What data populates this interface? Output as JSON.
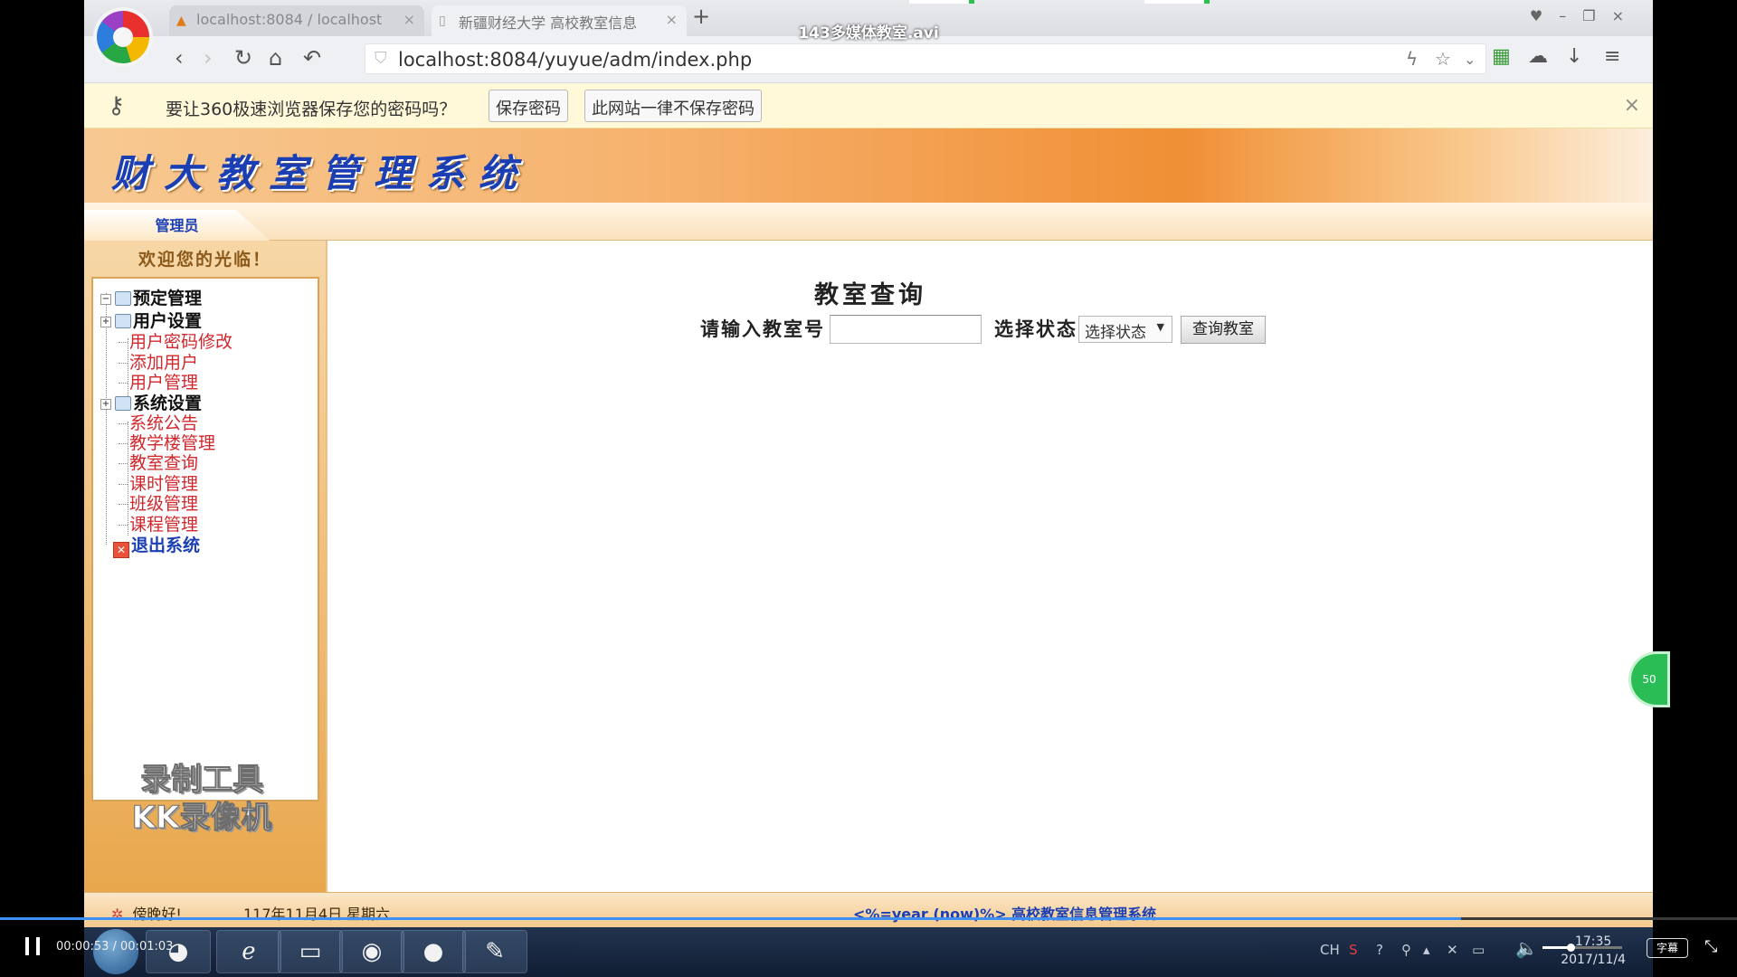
{
  "video": {
    "title": "143多媒体教室.avi",
    "time": "00:00:53 / 00:01:03",
    "progress": 0.841,
    "volume": 0.35,
    "subtitle_label": "字幕"
  },
  "browser": {
    "tabs": [
      {
        "label": "localhost:8084 / localhost",
        "icon": "phpmyadmin-icon"
      },
      {
        "label": "新疆财经大学 高校教室信息",
        "icon": "page-icon"
      }
    ],
    "new_tab": "+",
    "url": "localhost:8084/yuyue/adm/index.php",
    "password_bar": {
      "message": "要让360极速浏览器保存您的密码吗？",
      "save_label": "保存密码",
      "never_label": "此网站一律不保存密码",
      "close_icon": "×"
    }
  },
  "page": {
    "site_title": "财大教室管理系统",
    "role_tab": "管理员",
    "welcome": "欢迎您的光临！",
    "menu": {
      "reserve": "预定管理",
      "user_settings": "用户设置",
      "user_items": [
        "用户密码修改",
        "添加用户",
        "用户管理"
      ],
      "system_settings": "系统设置",
      "system_items": [
        "系统公告",
        "教学楼管理",
        "教室查询",
        "课时管理",
        "班级管理",
        "课程管理"
      ],
      "logout": "退出系统"
    },
    "watermark": [
      "录制工具",
      "KK录像机"
    ],
    "query": {
      "title": "教室查询",
      "room_label": "请输入教室号",
      "room_value": "",
      "status_label": "选择状态",
      "status_selected": "选择状态",
      "submit_label": "查询教室"
    },
    "footer": {
      "greeting": "傍晚好!",
      "date": "117年11月4日",
      "weekday": "星期六",
      "text": "<%=year (now)%> 高校教室信息管理系统"
    }
  },
  "taskbar": {
    "tray_lang": "CH",
    "clock_time": "17:35",
    "clock_date": "2017/11/4"
  },
  "colors": {
    "header_orange": "#f08f35",
    "title_blue": "#1b3fb3",
    "menu_red": "#d0282d",
    "progress_blue": "#3e8ef7"
  }
}
